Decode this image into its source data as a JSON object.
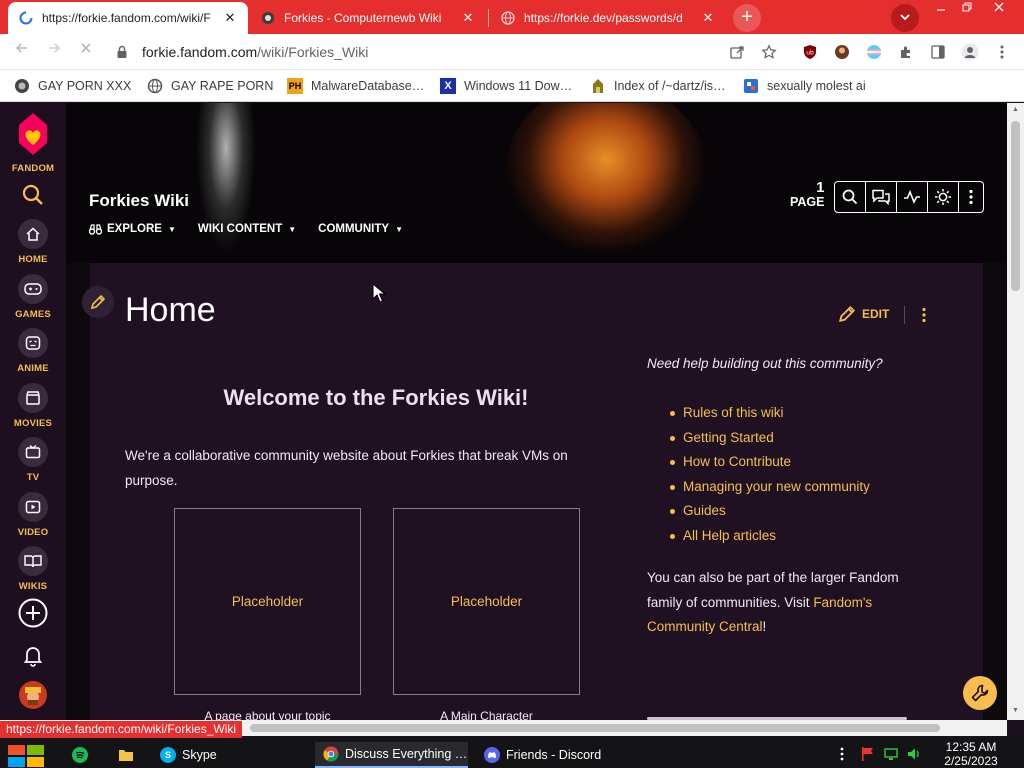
{
  "browser": {
    "tabs": [
      {
        "title": "https://forkie.fandom.com/wiki/F",
        "active": true
      },
      {
        "title": "Forkies - Computernewb Wiki",
        "active": false
      },
      {
        "title": "https://forkie.dev/passwords/d",
        "active": false
      }
    ],
    "close_glyph": "✕",
    "new_tab_glyph": "+",
    "url_host": "forkie.fandom.com",
    "url_path": "/wiki/Forkies_Wiki",
    "bookmarks": [
      "GAY PORN XXX",
      "GAY RAPE PORN",
      "MalwareDatabase…",
      "Windows 11 Dow…",
      "Index of /~dartz/is…",
      "sexually molest ai"
    ],
    "bookmark_badges": {
      "ph": "PH",
      "x": "X"
    },
    "status_url": "https://forkie.fandom.com/wiki/Forkies_Wiki"
  },
  "fandom_rail": {
    "brand": "FANDOM",
    "items": [
      "HOME",
      "GAMES",
      "ANIME",
      "MOVIES",
      "TV",
      "VIDEO",
      "WIKIS"
    ]
  },
  "wiki": {
    "title": "Forkies Wiki",
    "nav": [
      "EXPLORE",
      "WIKI CONTENT",
      "COMMUNITY"
    ],
    "page_count": "1",
    "page_label": "PAGE"
  },
  "article": {
    "title": "Home",
    "edit_label": "EDIT",
    "welcome": "Welcome to the Forkies Wiki!",
    "intro": "We're a collaborative community website about Forkies that break VMs on purpose.",
    "placeholders": [
      {
        "label": "Placeholder",
        "caption": "A page about your topic"
      },
      {
        "label": "Placeholder",
        "caption": "A Main Character"
      }
    ],
    "help_question": "Need help building out this community?",
    "help_links": [
      "Rules of this wiki",
      "Getting Started",
      "How to Contribute",
      "Managing your new community",
      "Guides",
      "All Help articles"
    ],
    "help_more_prefix": "You can also be part of the larger Fandom family of communities. Visit ",
    "help_more_link": "Fandom's Community Central",
    "help_more_suffix": "!"
  },
  "taskbar": {
    "items": [
      "Skype",
      "Discuss Everything …",
      "Friends - Discord"
    ],
    "time": "12:35 AM",
    "date": "2/25/2023"
  },
  "colors": {
    "accent": "#f7be4e",
    "chrome_red": "#e52e2e",
    "fandom_pink": "#fa005a"
  }
}
